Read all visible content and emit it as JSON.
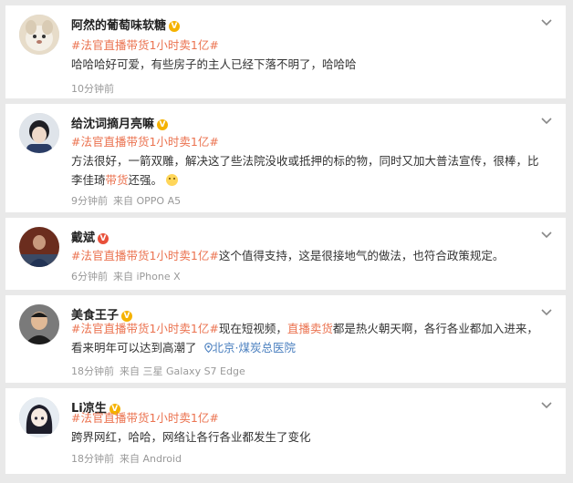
{
  "comments": [
    {
      "username": "阿然的葡萄味软糖",
      "badge": "V",
      "hashtag": "#法官直播带货1小时卖1亿#",
      "text_after_tag": "",
      "text": "哈哈哈好可爱，有些房子的主人已经下落不明了，哈哈哈",
      "time": "10分钟前",
      "source": ""
    },
    {
      "username": "给沈词摘月亮嘛",
      "badge": "V",
      "hashtag": "#法官直播带货1小时卖1亿#",
      "text_part1": "方法很好，一箭双雕，解决这了些法院没收或抵押的标的物，同时又加大普法宣传，很棒，比李佳琦",
      "highlight": "带货",
      "text_part2": "还强。",
      "emoji": "smiley-emoji",
      "time": "9分钟前",
      "source": "来自 OPPO A5"
    },
    {
      "username": "戴斌",
      "badge": "V",
      "hashtag": "#法官直播带货1小时卖1亿#",
      "text": "这个值得支持，这是很接地气的做法，也符合政策规定。",
      "time": "6分钟前",
      "source": "来自 iPhone X"
    },
    {
      "username": "美食王子",
      "badge": "V",
      "hashtag": "#法官直播带货1小时卖1亿#",
      "text_part1": "现在短视频，",
      "highlight": "直播卖货",
      "text_part2": "都是热火朝天啊，各行各业都加入进来，看来明年可以达到高潮了",
      "location": "北京·煤炭总医院",
      "time": "18分钟前",
      "source": "来自 三星 Galaxy S7 Edge"
    },
    {
      "username": "Li凉生",
      "badge": "V",
      "hashtag": "#法官直播带货1小时卖1亿#",
      "text": "跨界网红，哈哈，网络让各行各业都发生了变化",
      "time": "18分钟前",
      "source": "来自 Android"
    }
  ],
  "colors": {
    "hashtag": "#eb7350",
    "link": "#4a7fbf",
    "badge_gold": "#f5b200",
    "badge_red": "#e8503a",
    "meta": "#999999"
  }
}
